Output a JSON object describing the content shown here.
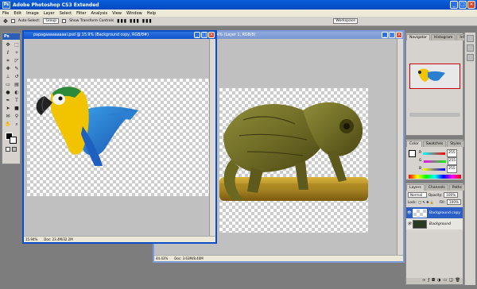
{
  "app": {
    "title": "Adobe Photoshop CS3 Extended",
    "logo": "Ps"
  },
  "window_controls": {
    "minimize": "_",
    "maximize": "□",
    "close": "×"
  },
  "menu": [
    "File",
    "Edit",
    "Image",
    "Layer",
    "Select",
    "Filter",
    "Analysis",
    "View",
    "Window",
    "Help"
  ],
  "options": {
    "auto_select_label": "Auto-Select:",
    "auto_select_value": "Group",
    "transform_label": "Show Transform Controls",
    "workspace_label": "Workspace"
  },
  "doc1": {
    "title": "papagaaaaaaaaai.psd @ 15.9% (Background copy, RGB/8#)",
    "zoom": "15.94%",
    "doc_info": "Doc: 23.4M/32.2M"
  },
  "doc2": {
    "title": "...4% (Layer 1, RGB/8)",
    "zoom": "44.43%",
    "doc_info": "Doc: 3.63M/8.40M"
  },
  "navigator": {
    "tabs": [
      "Navigator",
      "Histogram",
      "Info"
    ]
  },
  "color_panel": {
    "tabs": [
      "Color",
      "Swatches",
      "Styles"
    ],
    "sliders": [
      {
        "label": "R",
        "value": "255",
        "color": "#ff4040"
      },
      {
        "label": "G",
        "value": "255",
        "color": "#40c040"
      },
      {
        "label": "B",
        "value": "255",
        "color": "#4060ff"
      }
    ]
  },
  "layers_panel": {
    "tabs": [
      "Layers",
      "Channels",
      "Paths"
    ],
    "blend_mode": "Normal",
    "opacity_label": "Opacity:",
    "opacity_value": "100%",
    "lock_label": "Lock:",
    "fill_label": "Fill:",
    "fill_value": "100%",
    "layers": [
      {
        "name": "Background copy",
        "selected": true
      },
      {
        "name": "Background",
        "selected": false
      }
    ]
  },
  "colors": {
    "titlebar": "#0548c4",
    "workspace": "#7d7d7d",
    "selected_layer": "#2b5fc6"
  }
}
